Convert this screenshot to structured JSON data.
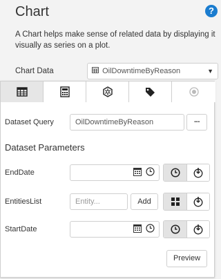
{
  "header": {
    "title": "Chart",
    "help_icon": "question-circle-icon",
    "description": "A Chart helps make sense of related data by displaying it visually as series on a plot."
  },
  "chart_data_field": {
    "label": "Chart Data",
    "value": "OilDowntimeByReason",
    "icon": "table-icon"
  },
  "popup": {
    "tabs": [
      {
        "icon": "table-icon",
        "active": true
      },
      {
        "icon": "calculator-icon",
        "active": false
      },
      {
        "icon": "hexagon-network-icon",
        "active": false
      },
      {
        "icon": "tag-icon",
        "active": false
      },
      {
        "icon": "radio-target-icon",
        "active": false
      }
    ],
    "dataset_query": {
      "label": "Dataset Query",
      "value": "OilDowntimeByReason",
      "more_label": "···"
    },
    "params_title": "Dataset Parameters",
    "params": [
      {
        "label": "EndDate",
        "value": "",
        "type": "date"
      },
      {
        "label": "EntitiesList",
        "placeholder": "Entity...",
        "add_label": "Add",
        "type": "list"
      },
      {
        "label": "StartDate",
        "value": "",
        "type": "date"
      }
    ],
    "preview_label": "Preview"
  }
}
